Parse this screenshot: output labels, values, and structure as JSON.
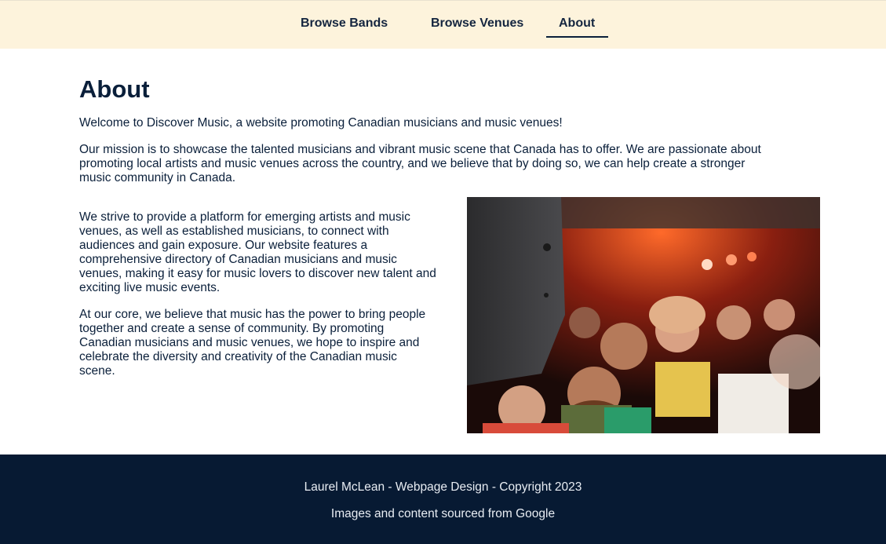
{
  "nav": {
    "items": [
      {
        "label": "Browse Bands",
        "active": false
      },
      {
        "label": "Browse Venues",
        "active": false
      },
      {
        "label": "About",
        "active": true
      }
    ]
  },
  "page": {
    "title": "About",
    "intro": "Welcome to Discover Music, a website promoting Canadian musicians and music venues!",
    "mission_line1": "Our mission is to showcase the talented musicians and vibrant music scene that Canada has to offer. We are passionate about",
    "mission_line2": "promoting local artists and music venues across the country, and we believe that by doing so, we can help create a stronger",
    "mission_line3": "music community in Canada.",
    "strive_line1": "We strive to provide a platform for emerging artists and music",
    "strive_line2": "venues, as well as established musicians, to connect with",
    "strive_line3": "audiences and gain exposure. Our website features a",
    "strive_line4": "comprehensive directory of Canadian musicians and music",
    "strive_line5": "venues, making it easy for music lovers to discover new talent and",
    "strive_line6": "exciting live music events.",
    "core_line1": "At our core, we believe that music has the power to bring people",
    "core_line2": "together and create a sense of community. By promoting",
    "core_line3": "Canadian musicians and music venues, we hope to inspire and",
    "core_line4": "celebrate the diversity and creativity of the Canadian music",
    "core_line5": "scene."
  },
  "colors": {
    "nav_bg": "#fdf3dc",
    "text": "#0a1f3a",
    "footer_bg": "#071a33"
  },
  "footer": {
    "credit": "Laurel McLean - Webpage Design - Copyright 2023",
    "source": "Images and content sourced from Google"
  }
}
